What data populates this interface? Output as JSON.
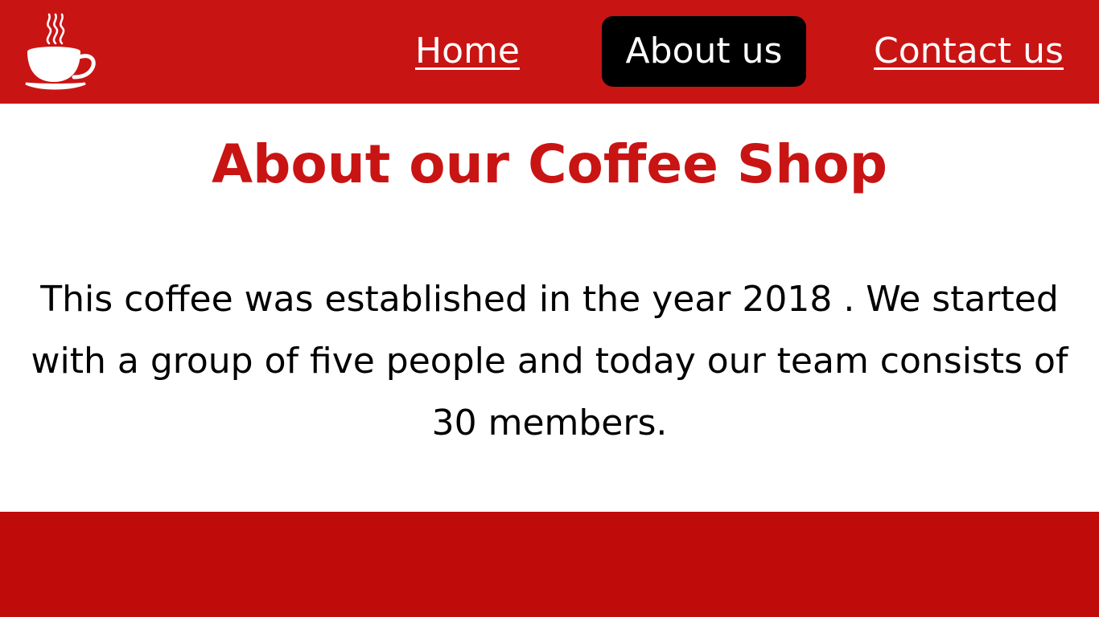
{
  "header": {
    "logo_icon": "coffee-cup-icon",
    "background_color": "#c91414"
  },
  "nav": {
    "items": [
      {
        "label": "Home",
        "active": false
      },
      {
        "label": "About us",
        "active": true
      },
      {
        "label": "Contact us",
        "active": false
      }
    ]
  },
  "main": {
    "title": "About our Coffee Shop",
    "text": "This coffee was established in the year 2018 . We started with a group of five people and today our team consists of 30 members."
  },
  "colors": {
    "brand_red": "#c91414",
    "footer_red": "#c00b0b",
    "active_nav": "#000000",
    "text": "#000000",
    "background": "#ffffff"
  }
}
